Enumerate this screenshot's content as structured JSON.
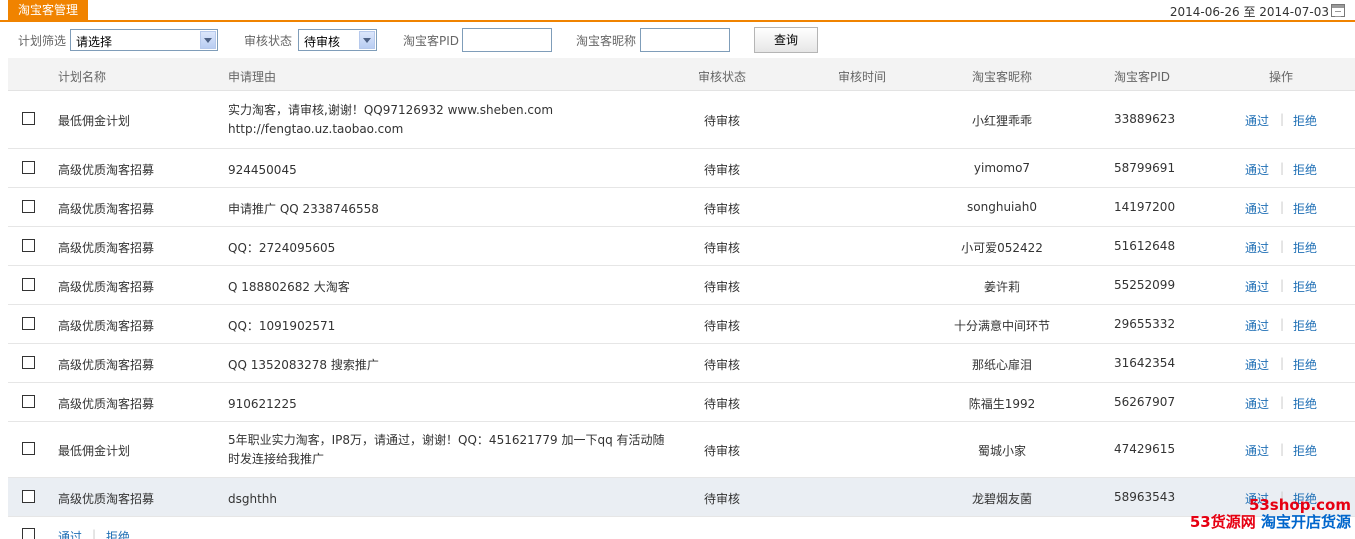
{
  "header": {
    "tab_label": "淘宝客管理",
    "date_range": "2014-06-26 至 2014-07-03"
  },
  "filters": {
    "plan_label": "计划筛选",
    "plan_value": "请选择",
    "status_label": "审核状态",
    "status_value": "待审核",
    "pid_label": "淘宝客PID",
    "pid_value": "",
    "nick_label": "淘宝客昵称",
    "nick_value": "",
    "query_button": "查询"
  },
  "table": {
    "columns": [
      "计划名称",
      "申请理由",
      "审核状态",
      "审核时间",
      "淘宝客昵称",
      "淘宝客PID",
      "操作"
    ],
    "approve_label": "通过",
    "reject_label": "拒绝",
    "rows": [
      {
        "plan": "最低佣金计划",
        "reason": "实力淘客，请审核,谢谢！QQ97126932 www.sheben.com http://fengtao.uz.taobao.com",
        "status": "待审核",
        "time": "",
        "nick": "小红狸乖乖",
        "pid": "33889623"
      },
      {
        "plan": "高级优质淘客招募",
        "reason": "924450045",
        "status": "待审核",
        "time": "",
        "nick": "yimomo7",
        "pid": "58799691"
      },
      {
        "plan": "高级优质淘客招募",
        "reason": "申请推广 QQ 2338746558",
        "status": "待审核",
        "time": "",
        "nick": "songhuiah0",
        "pid": "14197200"
      },
      {
        "plan": "高级优质淘客招募",
        "reason": "QQ：2724095605",
        "status": "待审核",
        "time": "",
        "nick": "小可爱052422",
        "pid": "51612648"
      },
      {
        "plan": "高级优质淘客招募",
        "reason": "Q 188802682 大淘客",
        "status": "待审核",
        "time": "",
        "nick": "姜许莉",
        "pid": "55252099"
      },
      {
        "plan": "高级优质淘客招募",
        "reason": "QQ：1091902571",
        "status": "待审核",
        "time": "",
        "nick": "十分满意中间环节",
        "pid": "29655332"
      },
      {
        "plan": "高级优质淘客招募",
        "reason": "QQ 1352083278 搜索推广",
        "status": "待审核",
        "time": "",
        "nick": "那纸心扉泪",
        "pid": "31642354"
      },
      {
        "plan": "高级优质淘客招募",
        "reason": "910621225",
        "status": "待审核",
        "time": "",
        "nick": "陈福生1992",
        "pid": "56267907"
      },
      {
        "plan": "最低佣金计划",
        "reason": "5年职业实力淘客，IP8万，请通过，谢谢！QQ：451621779 加一下qq 有活动随时发连接给我推广",
        "status": "待审核",
        "time": "",
        "nick": "蜀城小家",
        "pid": "47429615"
      },
      {
        "plan": "高级优质淘客招募",
        "reason": "dsghthh",
        "status": "待审核",
        "time": "",
        "nick": "龙碧烟友菌",
        "pid": "58963543"
      }
    ]
  },
  "footer": {
    "approve_label": "通过",
    "reject_label": "拒绝"
  },
  "watermark": {
    "line1": "53shop.com",
    "line2_red": "53货源网",
    "line2_blue": "淘宝开店货源"
  }
}
